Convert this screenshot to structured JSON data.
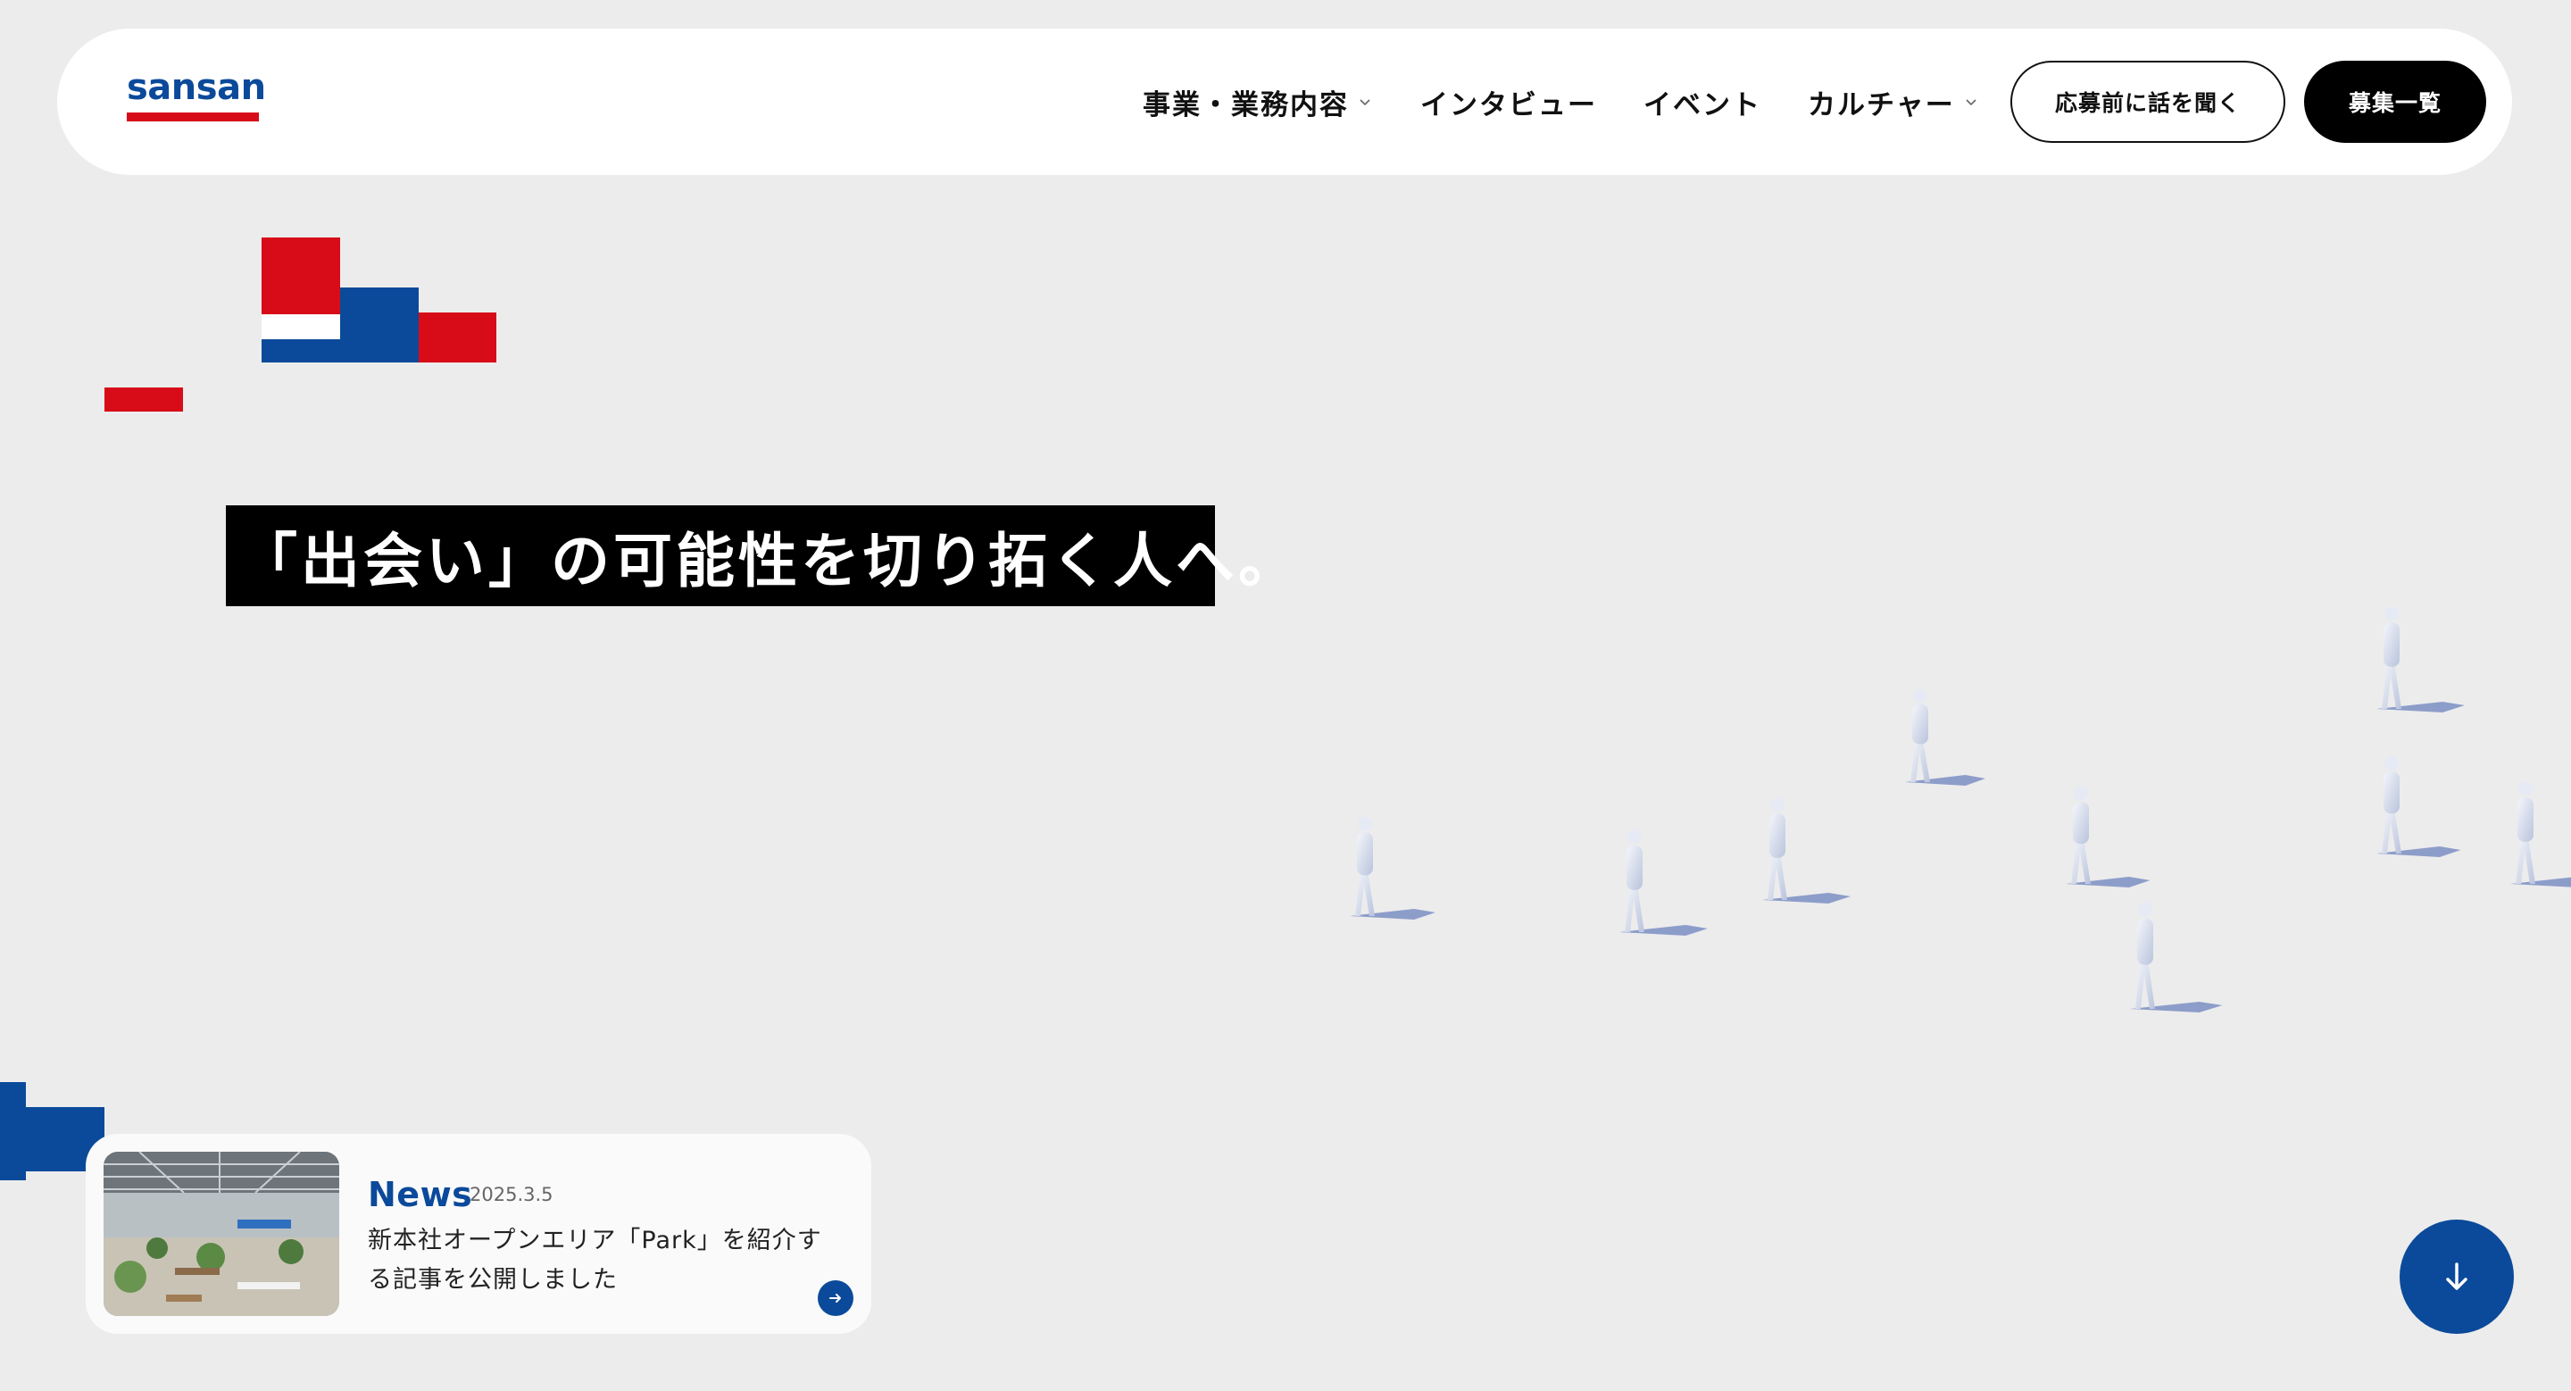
{
  "brand": {
    "logo_text": "sansan",
    "colors": {
      "red": "#d70c18",
      "blue": "#0b4a9a",
      "background": "#ececec"
    }
  },
  "nav": {
    "items": [
      {
        "label": "事業・業務内容",
        "has_dropdown": true
      },
      {
        "label": "インタビュー",
        "has_dropdown": false
      },
      {
        "label": "イベント",
        "has_dropdown": false
      },
      {
        "label": "カルチャー",
        "has_dropdown": true
      }
    ],
    "consult_label": "応募前に話を聞く",
    "jobs_label": "募集一覧"
  },
  "hero": {
    "headline": "「出会い」の可能性を切り拓く人へ。"
  },
  "news": {
    "label": "News",
    "date": "2025.3.5",
    "text": "新本社オープンエリア「Park」を紹介する記事を公開しました",
    "arrow_icon": "arrow-right-icon"
  },
  "scroll": {
    "icon": "arrow-down-icon"
  }
}
